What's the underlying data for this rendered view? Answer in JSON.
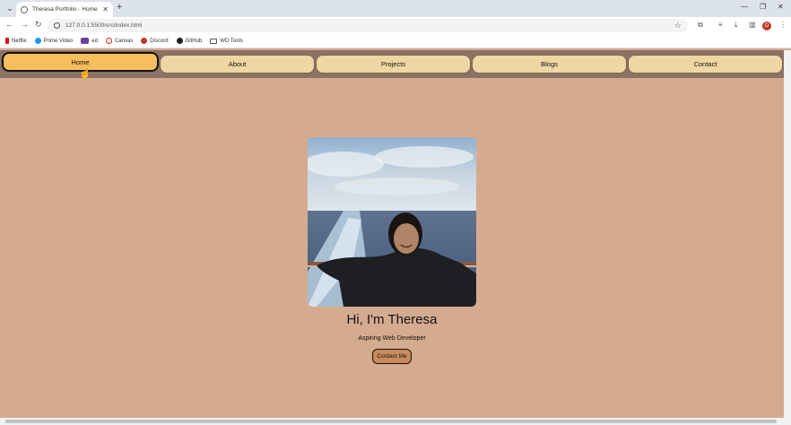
{
  "browser": {
    "tab_title": "Theresa Portfolio - Home",
    "tab_close": "✕",
    "new_tab": "+",
    "url": "127.0.0.1:5500/src/index.html",
    "bookmarks": [
      {
        "label": "Netflix",
        "color": "#e50914"
      },
      {
        "label": "Prime Video",
        "color": "#1a98ff"
      },
      {
        "label": "ed",
        "color": "#6a3ea1"
      },
      {
        "label": "Canvas",
        "color": "#e2231a"
      },
      {
        "label": "Discord",
        "color": "#c0392b"
      },
      {
        "label": "GitHub",
        "color": "#222222"
      },
      {
        "label": "WD Tools",
        "color": "#555555"
      }
    ],
    "profile_initial": "O"
  },
  "nav": {
    "items": [
      "Home",
      "About",
      "Projects",
      "Blogs",
      "Contact"
    ],
    "active": "Home"
  },
  "hero": {
    "title": "Hi, I'm Theresa",
    "subtitle": "Aspiring Web Developer",
    "button": "Contact Me"
  },
  "colors": {
    "page_bg": "#d5ab90",
    "navbar_bg": "#8a7265",
    "nav_item_bg": "#efd7a3",
    "nav_active_bg": "#f7be5d",
    "button_bg": "#c98a5c"
  }
}
